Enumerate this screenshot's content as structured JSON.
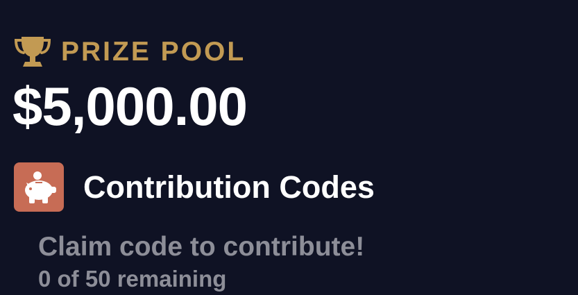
{
  "prize_pool": {
    "label": "PRIZE POOL",
    "amount": "$5,000.00",
    "icon": "trophy-icon",
    "accent_color": "#c29a53"
  },
  "contribution": {
    "title": "Contribution Codes",
    "icon": "piggy-bank-icon",
    "icon_bg_color": "#c76c55",
    "cta_text": "Claim code to contribute!",
    "remaining_text": "0 of 50 remaining",
    "remaining_count": 0,
    "total_count": 50
  },
  "theme": {
    "background": "#0f1224",
    "muted_text": "#8d8e98"
  }
}
